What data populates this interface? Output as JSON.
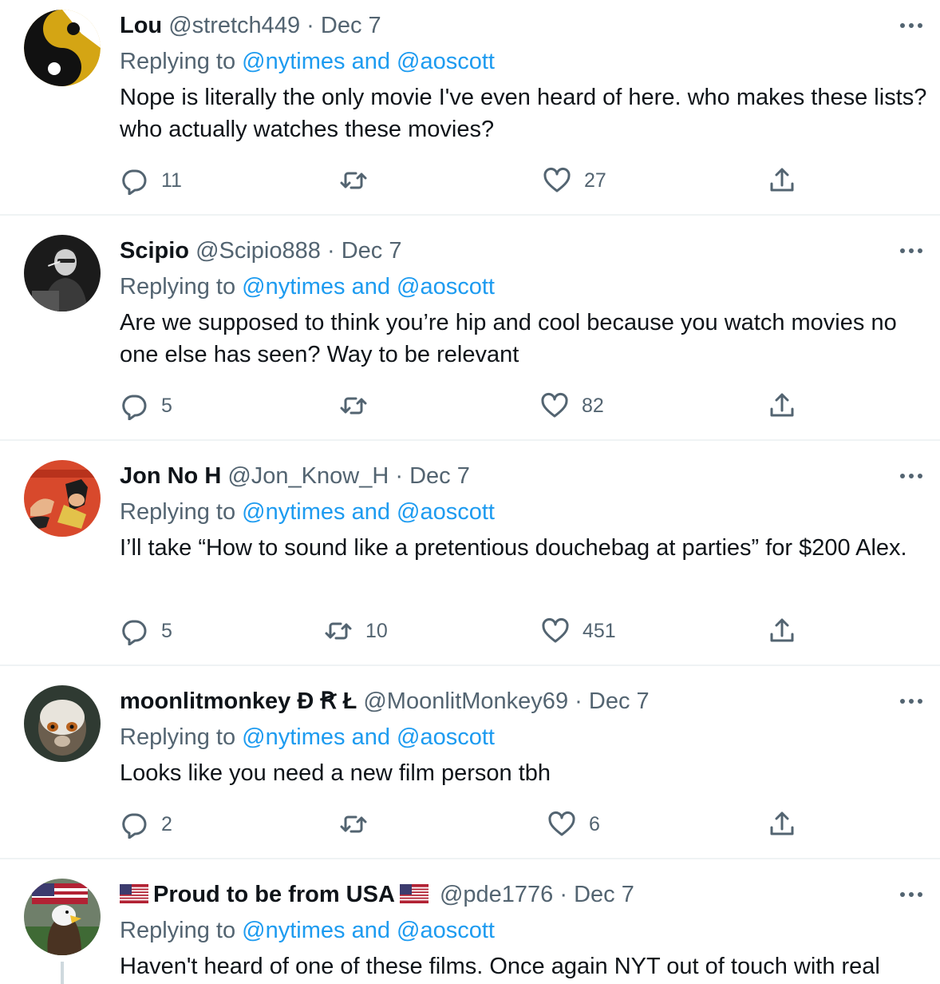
{
  "reply_prefix": "Replying to",
  "reply_and": "and",
  "colors": {
    "text_primary": "#0f1419",
    "text_secondary": "#536471",
    "accent": "#1d9bf0",
    "divider": "#eff3f4"
  },
  "tweets": [
    {
      "name": "Lou",
      "handle": "@stretch449",
      "sep": "·",
      "date": "Dec 7",
      "mention1": "@nytimes",
      "mention2": "@aoscott",
      "text": "Nope is literally the only movie I've even heard of here. who makes these lists? who actually watches these movies?",
      "replies": "11",
      "retweets": "",
      "likes": "27",
      "avatar_icon": "yin-yang-icon"
    },
    {
      "name": "Scipio",
      "handle": "@Scipio888",
      "sep": "·",
      "date": "Dec 7",
      "mention1": "@nytimes",
      "mention2": "@aoscott",
      "text": "Are we supposed to think you’re hip and cool because you watch movies no one else has seen? Way to be relevant",
      "replies": "5",
      "retweets": "",
      "likes": "82",
      "avatar_icon": "man-portrait-icon"
    },
    {
      "name": "Jon No H",
      "handle": "@Jon_Know_H",
      "sep": "·",
      "date": "Dec 7",
      "mention1": "@nytimes",
      "mention2": "@aoscott",
      "text": "I’ll take “How to sound like a pretentious douchebag at parties” for $200 Alex.",
      "replies": "5",
      "retweets": "10",
      "likes": "451",
      "avatar_icon": "comic-slap-icon"
    },
    {
      "name": "moonlitmonkey Ð Ꞧ Ł",
      "handle": "@MoonlitMonkey69",
      "sep": "·",
      "date": "Dec 7",
      "mention1": "@nytimes",
      "mention2": "@aoscott",
      "text": "Looks like you need a new film person tbh",
      "replies": "2",
      "retweets": "",
      "likes": "6",
      "avatar_icon": "monkey-icon"
    },
    {
      "name": "Proud to be from USA",
      "handle": "@pde1776",
      "sep": "·",
      "date": "Dec 7",
      "mention1": "@nytimes",
      "mention2": "@aoscott",
      "text": "Haven't heard of one of these films. Once again NYT out of touch with real",
      "replies": "",
      "retweets": "",
      "likes": "",
      "avatar_icon": "eagle-flag-icon",
      "flag_icon": "us-flag-icon"
    }
  ]
}
